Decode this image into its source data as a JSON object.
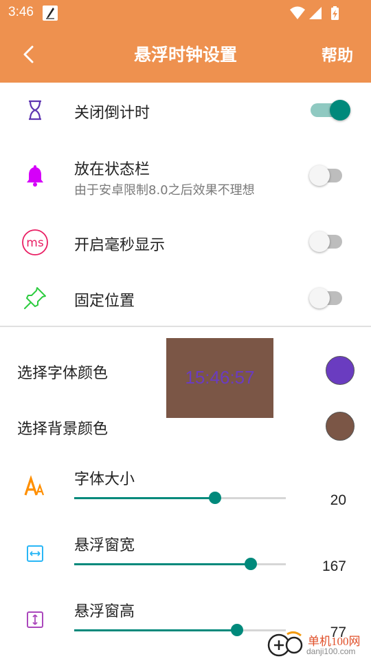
{
  "status_bar": {
    "time": "3:46",
    "icons": [
      "notification-icon",
      "wifi-icon",
      "signal-icon",
      "battery-charging-icon"
    ]
  },
  "app_bar": {
    "title": "悬浮时钟设置",
    "help": "帮助",
    "back_icon": "arrow-back-icon"
  },
  "toggles": [
    {
      "label": "关闭倒计时",
      "sub": "",
      "on": true,
      "icon": "hourglass-icon"
    },
    {
      "label": "放在状态栏",
      "sub": "由于安卓限制8.0之后效果不理想",
      "on": false,
      "icon": "bell-icon"
    },
    {
      "label": "开启毫秒显示",
      "sub": "",
      "on": false,
      "icon": "ms-icon",
      "icon_text": "ms"
    },
    {
      "label": "固定位置",
      "sub": "",
      "on": false,
      "icon": "pin-icon"
    }
  ],
  "colors": {
    "font_color_label": "选择字体颜色",
    "bg_color_label": "选择背景颜色",
    "font_color": "#6a3cc0",
    "bg_color": "#7b5646",
    "preview_time": "15:46:57"
  },
  "sliders": [
    {
      "label": "字体大小",
      "value": "20",
      "fraction": 0.665,
      "icon": "font-size-icon"
    },
    {
      "label": "悬浮窗宽",
      "value": "167",
      "fraction": 0.833,
      "icon": "width-icon"
    },
    {
      "label": "悬浮窗高",
      "value": "77",
      "fraction": 0.77,
      "icon": "height-icon"
    }
  ],
  "theme": {
    "primary": "#ee914f",
    "accent": "#00897b"
  },
  "watermark": {
    "line1": "单机100网",
    "line2": "danji100.com"
  }
}
